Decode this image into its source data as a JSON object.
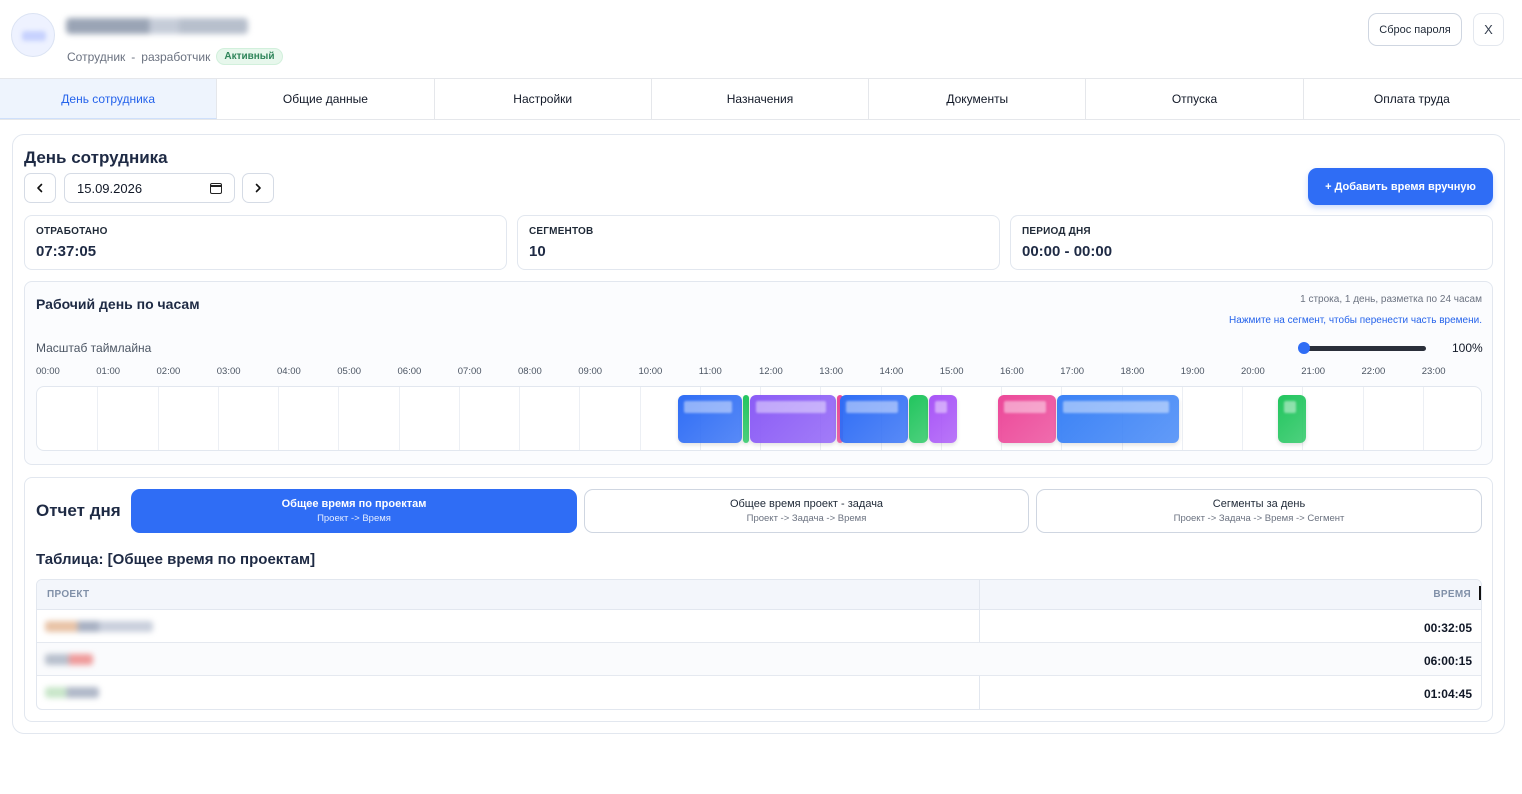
{
  "header": {
    "role": "Сотрудник",
    "separator": "-",
    "position": "разработчик",
    "status": "Активный",
    "reset_password_label": "Сброс пароля",
    "close_label": "X"
  },
  "tabs": [
    {
      "label": "День сотрудника",
      "active": true
    },
    {
      "label": "Общие данные"
    },
    {
      "label": "Настройки"
    },
    {
      "label": "Назначения"
    },
    {
      "label": "Документы"
    },
    {
      "label": "Отпуска"
    },
    {
      "label": "Оплата труда"
    }
  ],
  "day": {
    "title": "День сотрудника",
    "date": "15.09.2026",
    "add_time_label": "+ Добавить время вручную"
  },
  "stats": [
    {
      "label": "ОТРАБОТАНО",
      "value": "07:37:05"
    },
    {
      "label": "СЕГМЕНТОВ",
      "value": "10"
    },
    {
      "label": "ПЕРИОД ДНЯ",
      "value": "00:00 - 00:00"
    }
  ],
  "timeline": {
    "title": "Рабочий день по часам",
    "info": "1 строка, 1 день, разметка по 24 часам",
    "hint": "Нажмите на сегмент, чтобы перенести часть времени.",
    "scale_label": "Масштаб таймлайна",
    "zoom": "100%",
    "zoom_fraction": 0.0,
    "hours": [
      "00:00",
      "01:00",
      "02:00",
      "03:00",
      "04:00",
      "05:00",
      "06:00",
      "07:00",
      "08:00",
      "09:00",
      "10:00",
      "11:00",
      "12:00",
      "13:00",
      "14:00",
      "15:00",
      "16:00",
      "17:00",
      "18:00",
      "19:00",
      "20:00",
      "21:00",
      "22:00",
      "23:00"
    ],
    "segments": [
      {
        "start": "10:38",
        "end": "11:43",
        "color": "#2f6df5"
      },
      {
        "start": "11:43",
        "end": "11:50",
        "color": "#22c55e"
      },
      {
        "start": "11:50",
        "end": "13:17",
        "color": "#8b5cf6"
      },
      {
        "start": "13:17",
        "end": "13:20",
        "color": "#ec4899"
      },
      {
        "start": "13:20",
        "end": "14:28",
        "color": "#2f6df5"
      },
      {
        "start": "14:28",
        "end": "14:48",
        "color": "#22c55e"
      },
      {
        "start": "14:48",
        "end": "15:17",
        "color": "#a855f7"
      },
      {
        "start": "15:57",
        "end": "16:56",
        "color": "#ec4899"
      },
      {
        "start": "16:56",
        "end": "18:58",
        "color": "#3b82f6"
      },
      {
        "start": "20:36",
        "end": "21:05",
        "color": "#22c55e"
      }
    ]
  },
  "report": {
    "title": "Отчет дня",
    "modes": [
      {
        "title": "Общее время по проектам",
        "sub": "Проект -> Время",
        "active": true
      },
      {
        "title": "Общее время проект - задача",
        "sub": "Проект -> Задача -> Время"
      },
      {
        "title": "Сегменты за день",
        "sub": "Проект -> Задача -> Время -> Сегмент"
      }
    ],
    "table_title": "Таблица: [Общее время по проектам]",
    "columns": [
      "ПРОЕКТ",
      "ВРЕМЯ"
    ],
    "rows": [
      {
        "time": "00:32:05"
      },
      {
        "time": "06:00:15"
      },
      {
        "time": "01:04:45"
      }
    ]
  }
}
